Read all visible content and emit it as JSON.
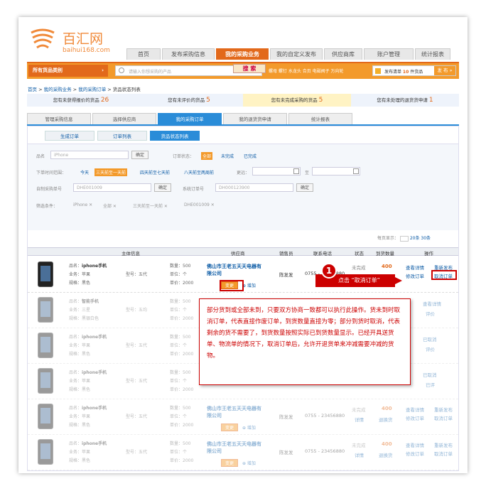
{
  "logo": {
    "name": "百汇网",
    "url": "baihui168.com"
  },
  "nav": {
    "tabs": [
      "首页",
      "发布采购信息",
      "我的采购业务",
      "我的自定义发布",
      "供应商库",
      "账户管理",
      "统计报表"
    ],
    "active": 2
  },
  "bar": {
    "category": "所有货品类别",
    "category_arrow": "›",
    "search_placeholder": "请输入你想采购的产品",
    "search_button": "搜 索",
    "hot": "螺母  螺钉  水龙头  合页  电磁阀子  万向轮",
    "publish_text_pre": "发布清单 ",
    "publish_count": "10",
    "publish_text_post": " 件货品",
    "publish_button": "发 布 »"
  },
  "breadcrumb": {
    "items": [
      "首页",
      "我的采购业务",
      "我的采购订单",
      "货品状态列表"
    ],
    "sep": " > "
  },
  "stats": [
    {
      "label": "您有未获得报价的货品 ",
      "value": "26"
    },
    {
      "label": "您有未评价的货品 ",
      "value": "5"
    },
    {
      "label": "您有未完成采购的货品 ",
      "value": "5"
    },
    {
      "label": "您有未处理的退货货申请 ",
      "value": "1"
    }
  ],
  "subtabs": [
    "管理采购信息",
    "选择供应商",
    "我的采购订单",
    "我的退货货申请",
    "统计报表"
  ],
  "minitabs": [
    "生成订单",
    "订单列表",
    "货品状态列表"
  ],
  "filters": {
    "name_label": "品名",
    "name_value": "iPhone",
    "ok": "确定",
    "status_label": "订单状态：",
    "status_all": "全部",
    "status_undone": "未完成",
    "status_done": "已完成",
    "time_label": "下单时间范围：",
    "t1": "今天",
    "t2": "三天前至一天前",
    "t3": "四天前至七天前",
    "t4": "八天前至两周前",
    "t5": "更远：",
    "date_to": "至",
    "self_label": "自制采购单号",
    "self_value": "DHE001009",
    "sys_label": "系统订单号",
    "sys_value": "DH000123900",
    "cond_label": "筛选条件：",
    "c1": "iPhone",
    "c2": "全部",
    "c3": "三天前至一天前",
    "c4": "DHE001009",
    "pager_label": "每页显示：",
    "p1": "10条",
    "p2": "20条",
    "p3": "30条"
  },
  "table": {
    "headers": [
      "主体信息",
      "供应商",
      "销售员",
      "联系电话",
      "状态",
      "到货数量",
      "操作"
    ]
  },
  "rows": [
    {
      "name": "iphone手机",
      "biz": "苹果",
      "spec": "黑色",
      "model": "五代",
      "qty": "500",
      "unit": "个",
      "price": "2000",
      "supplier": "佛山市王老五天天电器有限公司",
      "seller": "陈发发",
      "phone": "0755 - 23456880",
      "status": "未完成",
      "status2": "详情",
      "arrive": "400",
      "arrive2": "退换货",
      "op1": "查看详情",
      "op2": "重新发布",
      "op3": "修改订单",
      "op4": "取消订单",
      "change": "变更",
      "add": "⊕ 增加"
    },
    {
      "name": "智能手机",
      "biz": "三星",
      "spec": "黑银白色",
      "model": "五均",
      "qty": "500",
      "unit": "个",
      "price": "2000",
      "op1": "查看详情",
      "op3": "评价"
    },
    {
      "name": "iphone手机",
      "biz": "苹果",
      "spec": "黑色",
      "model": "五代",
      "qty": "500",
      "unit": "个",
      "price": "2000",
      "op1": "已取消",
      "op3": "评价"
    },
    {
      "name": "iphone手机",
      "biz": "苹果",
      "spec": "黑色",
      "model": "五代",
      "qty": "500",
      "unit": "个",
      "price": "2000",
      "op1": "已取消",
      "op3": "已评"
    },
    {
      "name": "iphone手机",
      "biz": "苹果",
      "spec": "黑色",
      "model": "五代",
      "qty": "500",
      "unit": "个",
      "price": "2000",
      "supplier": "佛山市王老五天天电器有限公司",
      "seller": "陈发发",
      "phone": "0755 - 23456880",
      "status": "未完成",
      "status2": "详情",
      "arrive": "400",
      "arrive2": "退换货",
      "op1": "查看详情",
      "op2": "重新发布",
      "op3": "修改订单",
      "op4": "取消订单",
      "change": "变更",
      "add": "⊕ 增加"
    },
    {
      "name": "iphone手机",
      "biz": "苹果",
      "spec": "黑色",
      "model": "五代",
      "qty": "500",
      "unit": "个",
      "price": "2000",
      "supplier": "佛山市王老五天天电器有限公司",
      "seller": "陈发发",
      "phone": "0755 - 23456880",
      "status": "未完成",
      "status2": "详情",
      "arrive": "400",
      "arrive2": "退换货",
      "op1": "查看详情",
      "op2": "重新发布",
      "op3": "修改订单",
      "op4": "取消订单",
      "change": "变更",
      "add": "⊕ 增加"
    }
  ],
  "labels": {
    "name": "品名：",
    "biz": "业务：",
    "spec": "规格：",
    "model": "型号：",
    "qty": "数量：",
    "unit": "单位：",
    "price": "单价："
  },
  "callout": {
    "num": "1",
    "text": "点击 “取消订单”"
  },
  "tip": "部分货到或全部未到，只要双方协商一致都可以执行此操作。货未到时取消订单，代表直接作废订单，到货数量直接为零；部分到货时取消，代表剩余的货不需要了，到货数量按照实际已到货数量显示。已经开具送货单、物流单的情况下，取消订单后，允许开退货单来冲减需要冲减的货物。"
}
